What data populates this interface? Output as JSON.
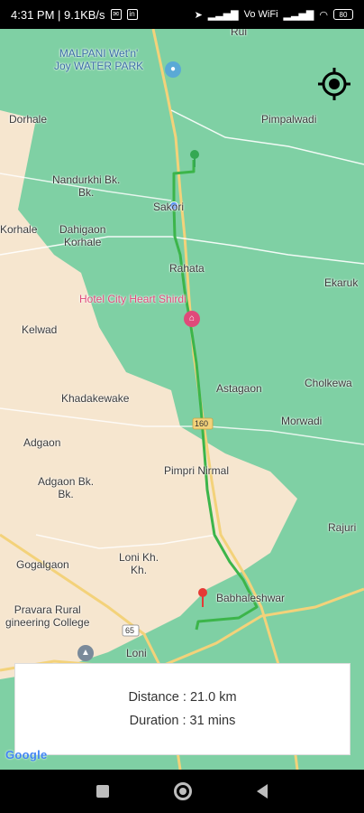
{
  "status_bar": {
    "time_speed": "4:31 PM | 9.1KB/s",
    "network_label": "Vo WiFi",
    "battery": "80"
  },
  "map": {
    "labels": {
      "malpani": "MALPANI Wet'n'\nJoy WATER PARK",
      "rui": "Rui",
      "dorhale": "Dorhale",
      "pimpalwadi": "Pimpalwadi",
      "nandurkhi": "Nandurkhi Bk.\nBk.",
      "sakori": "Sakori",
      "korhale": "Korhale",
      "dahigaon": "Dahigaon\nKorhale",
      "rahata": "Rahata",
      "ekaruk": "Ekaruk",
      "hotel": "Hotel City Heart Shirdi",
      "kelwad": "Kelwad",
      "astagaon": "Astagaon",
      "cholkewadi": "Cholkewa",
      "khadakewake": "Khadakewake",
      "morwadi": "Morwadi",
      "adgaon": "Adgaon",
      "pimpri": "Pimpri Nirmal",
      "adgaon_bk": "Adgaon Bk.\nBk.",
      "rajuri": "Rajuri",
      "gogalgaon": "Gogalgaon",
      "loni_kh": "Loni Kh.\nKh.",
      "babhaleshwar": "Babhaleshwar",
      "pravara": "Pravara Rural\ngineering College",
      "loni": "Loni",
      "route160": "160",
      "route65": "65"
    }
  },
  "route_info": {
    "distance": "Distance : 21.0 km",
    "duration": "Duration : 31 mins"
  },
  "google_logo": "Google",
  "colors": {
    "map_green": "#7fd0a4",
    "land_beige": "#f6e6cf",
    "route_green": "#3cb54a",
    "road_yellow": "#f3d27a",
    "marker_red": "#e53935",
    "marker_green": "#34a853",
    "marker_blue": "#4285f4"
  }
}
